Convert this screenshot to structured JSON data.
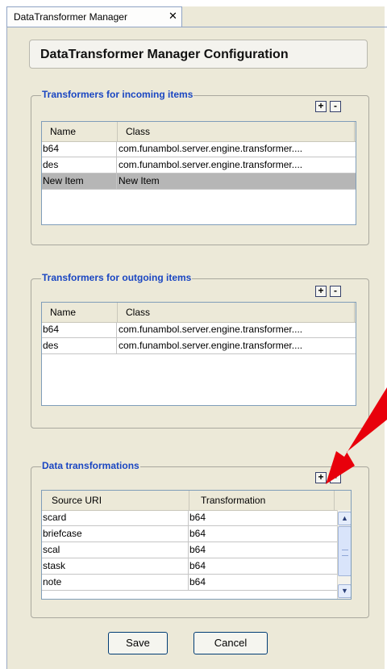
{
  "tab": {
    "label": "DataTransformer Manager",
    "close": "✕"
  },
  "title": "DataTransformer Manager Configuration",
  "incoming": {
    "title": "Transformers for incoming items",
    "add": "+",
    "remove": "-",
    "columns": [
      "Name",
      "Class"
    ],
    "rows": [
      {
        "name": "b64",
        "class": "com.funambol.server.engine.transformer...."
      },
      {
        "name": "des",
        "class": "com.funambol.server.engine.transformer...."
      },
      {
        "name": "New Item",
        "class": "New Item"
      }
    ]
  },
  "outgoing": {
    "title": "Transformers for outgoing items",
    "add": "+",
    "remove": "-",
    "columns": [
      "Name",
      "Class"
    ],
    "rows": [
      {
        "name": "b64",
        "class": "com.funambol.server.engine.transformer...."
      },
      {
        "name": "des",
        "class": "com.funambol.server.engine.transformer...."
      }
    ]
  },
  "data_transformations": {
    "title": "Data transformations",
    "add": "+",
    "remove": "-",
    "columns": [
      "Source URI",
      "Transformation"
    ],
    "rows": [
      {
        "source": "scard",
        "transformation": "b64"
      },
      {
        "source": "briefcase",
        "transformation": "b64"
      },
      {
        "source": "scal",
        "transformation": "b64"
      },
      {
        "source": "stask",
        "transformation": "b64"
      },
      {
        "source": "note",
        "transformation": "b64"
      }
    ],
    "scroll_up": "▲",
    "scroll_down": "▼"
  },
  "buttons": {
    "save": "Save",
    "cancel": "Cancel"
  },
  "colors": {
    "group_title": "#1a46c2",
    "panel_bg": "#ece9d8",
    "arrow": "#e8000b",
    "selected_row": "#b6b6b6"
  },
  "icons": {
    "annotation": "red-arrow-icon"
  }
}
